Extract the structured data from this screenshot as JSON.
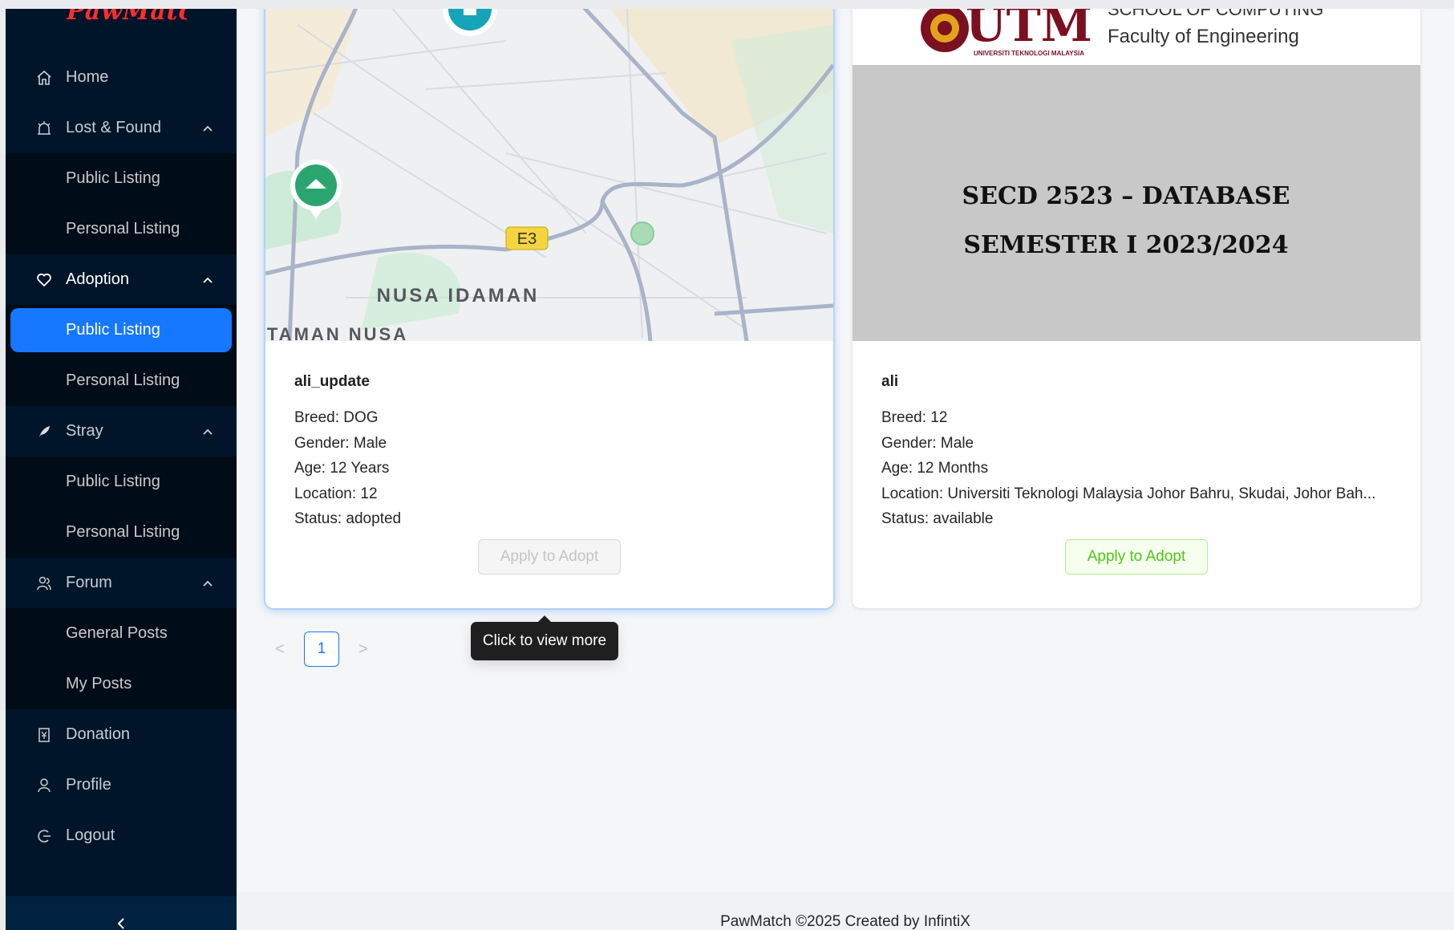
{
  "brand": "PawMatch",
  "sidebar": {
    "items": [
      {
        "label": "Home",
        "icon": "home-icon"
      },
      {
        "label": "Lost & Found",
        "icon": "alarm-icon"
      },
      {
        "label": "Public Listing"
      },
      {
        "label": "Personal Listing"
      },
      {
        "label": "Adoption",
        "icon": "heart-icon"
      },
      {
        "label": "Public Listing"
      },
      {
        "label": "Personal Listing"
      },
      {
        "label": "Stray",
        "icon": "feather-icon"
      },
      {
        "label": "Public Listing"
      },
      {
        "label": "Personal Listing"
      },
      {
        "label": "Forum",
        "icon": "team-icon"
      },
      {
        "label": "General Posts"
      },
      {
        "label": "My Posts"
      },
      {
        "label": "Donation",
        "icon": "account-book-icon"
      },
      {
        "label": "Profile",
        "icon": "user-icon"
      },
      {
        "label": "Logout",
        "icon": "logout-icon"
      }
    ],
    "collapse_label": "<"
  },
  "cards": [
    {
      "name": "ali_update",
      "breed": "Breed: DOG",
      "gender": "Gender: Male",
      "age": "Age: 12 Years",
      "location": "Location: 12",
      "status": "Status: adopted",
      "button": "Apply to Adopt",
      "map_label_area": "NUSA IDAMAN",
      "map_label_area2": "TAMAN NUSA",
      "map_road": "E3"
    },
    {
      "name": "ali",
      "breed": "Breed: 12",
      "gender": "Gender: Male",
      "age": "Age: 12 Months",
      "location": "Location: Universiti Teknologi Malaysia Johor Bahru, Skudai, Johor Bah...",
      "status": "Status: available",
      "button": "Apply to Adopt",
      "cover_logo": "UTM",
      "cover_logo_sub": "UNIVERSITI TEKNOLOGI MALAYSIA",
      "cover_school": "SCHOOL OF COMPUTING",
      "cover_faculty": "Faculty of Engineering",
      "cover_line1": "SECD 2523 – DATABASE",
      "cover_line2": "SEMESTER I 2023/2024"
    }
  ],
  "pagination": {
    "current": "1",
    "prev": "<",
    "next": ">"
  },
  "tooltip": "Click to view more",
  "footer": "PawMatch ©2025 Created by InfintiX",
  "colors": {
    "sider": "#001529",
    "submenu": "#000c17",
    "selected": "#1677ff",
    "success": "#52c41a"
  }
}
